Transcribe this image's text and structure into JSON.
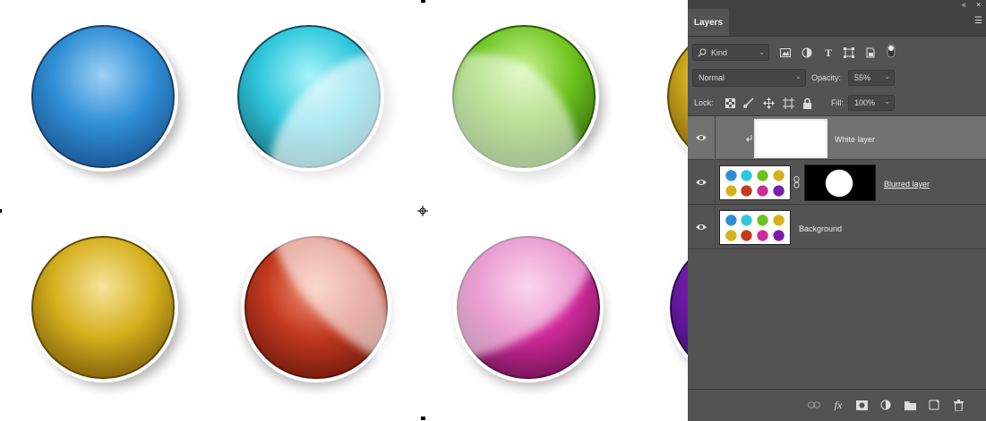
{
  "panel": {
    "collapse_icon": "double-chevron-left-icon",
    "close_icon": "close-icon",
    "tab_label": "Layers",
    "menu_icon": "hamburger-menu-icon"
  },
  "filter": {
    "kind_label": "Kind",
    "icons": [
      "image-filter-icon",
      "adjustment-filter-icon",
      "type-filter-icon",
      "shape-filter-icon",
      "smart-object-filter-icon",
      "filter-toggle-icon"
    ]
  },
  "blend": {
    "mode": "Normal",
    "opacity_label": "Opacity:",
    "opacity_value": "55%"
  },
  "lock": {
    "label": "Lock:",
    "icons": [
      "lock-transparent-pixels-icon",
      "lock-image-pixels-icon",
      "lock-position-icon",
      "lock-artboard-icon",
      "lock-all-icon"
    ],
    "fill_label": "Fill:",
    "fill_value": "100%"
  },
  "layers": [
    {
      "name": "White layer",
      "selected": true,
      "clipped": true,
      "has_mask": false
    },
    {
      "name": "Blurred layer",
      "selected": false,
      "clipped": false,
      "has_mask": true
    },
    {
      "name": "Background",
      "selected": false,
      "clipped": false,
      "has_mask": false
    }
  ],
  "bottom_icons": [
    "link-layers-icon",
    "fx-icon",
    "add-mask-icon",
    "adjustment-layer-icon",
    "new-group-icon",
    "new-layer-icon",
    "delete-icon"
  ],
  "colors": {
    "panel_bg": "#535353",
    "panel_dark": "#424242",
    "selected_row": "#717171",
    "sphere_blue": "#2f8fd6",
    "sphere_cyan": "#30c8dc",
    "sphere_green": "#6cc21e",
    "sphere_yellow": "#d6b11e",
    "sphere_red": "#c43a20",
    "sphere_magenta": "#d02a9a",
    "sphere_purple": "#7a1cb0"
  }
}
